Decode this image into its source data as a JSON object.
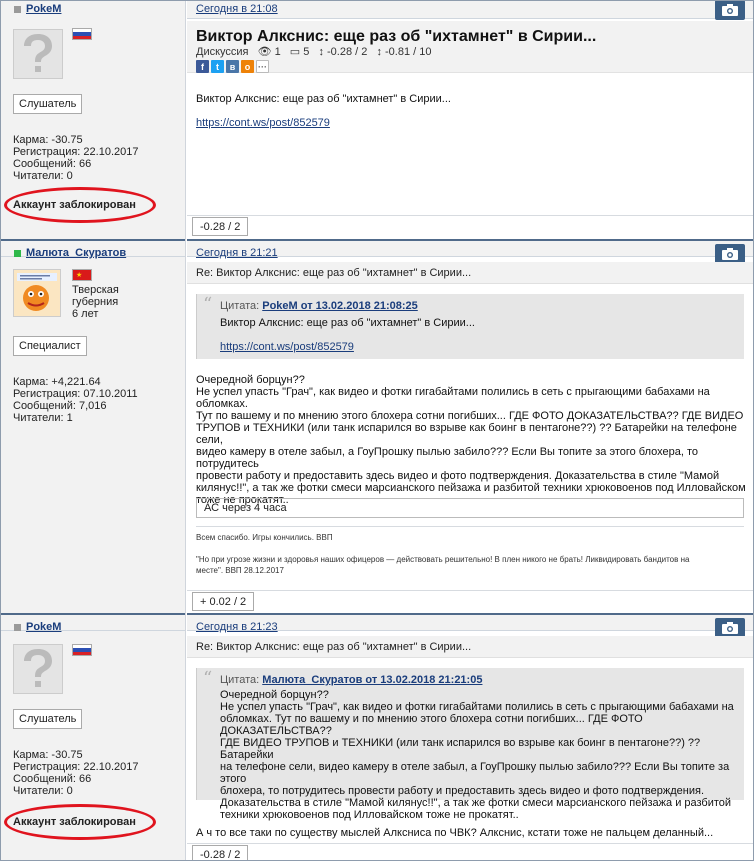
{
  "posts": [
    {
      "user": {
        "name": "PokeM",
        "role": "Слушатель",
        "karma": "Карма: -30.75",
        "registered": "Регистрация: 22.10.2017",
        "messages": "Сообщений: 66",
        "readers": "Читатели: 0",
        "status": "Аккаунт заблокирован"
      },
      "date": "Сегодня в 21:08",
      "title": "Виктор Алкснис: еще раз об \"ихтамнет\" в Сирии...",
      "meta": {
        "section": "Дискуссия",
        "views": "1",
        "comments": "5",
        "rating1": "-0.28 / 2",
        "rating2": "-0.81 / 10"
      },
      "body": "Виктор Алкснис: еще раз об \"ихтамнет\" в Сирии...",
      "link": "https://cont.ws/post/852579",
      "rating": "-0.28 / 2"
    },
    {
      "user": {
        "name": "Малюта_Скуратов",
        "region1": "Тверская",
        "region2": "губерния",
        "years": "6 лет",
        "role": "Специалист",
        "karma": "Карма: +4,221.64",
        "registered": "Регистрация: 07.10.2011",
        "messages": "Сообщений: 7,016",
        "readers": "Читатели: 1"
      },
      "date": "Сегодня в 21:21",
      "subject": "Re: Виктор Алкснис: еще раз об \"ихтамнет\" в Сирии...",
      "quote": {
        "label": "Цитата:",
        "author": "PokeM от 13.02.2018 21:08:25",
        "text": "Виктор Алкснис: еще раз об \"ихтамнет\" в Сирии...",
        "link": "https://cont.ws/post/852579"
      },
      "body_lines": [
        "Очередной борцун??",
        "Не успел упасть \"Грач\", как видео и фотки гигабайтами полились в сеть с прыгающими бабахами на обломках.",
        "Тут по вашему и по мнению этого блохера сотни погибших... ГДЕ ФОТО ДОКАЗАТЕЛЬСТВА?? ГДЕ ВИДЕО",
        "ТРУПОВ и ТЕХНИКИ (или танк испарился во взрыве как боинг в пентагоне??) ?? Батарейки на телефоне сели,",
        "видео камеру в отеле забыл, а ГоуПрошку пылью забило??? Если Вы топите за этого блохера, то потрудитесь",
        "провести работу и предоставить здесь видео и фото подтверждения. Доказательства в стиле \"Мамой",
        "килянус!!\", а так же фотки смеси марсианского пейзажа и разбитой техники хрюковоенов под Илловайском",
        "тоже не прокатят.."
      ],
      "edited": "АС через 4 часа",
      "sig1": "Всем спасибо. Игры кончились. ВВП",
      "sig2a": "\"Но при угрозе жизни и здоровья наших офицеров — действовать решительно! В плен никого не брать! Ликвидировать бандитов на",
      "sig2b": "месте\". ВВП 28.12.2017",
      "rating": "+ 0.02 / 2"
    },
    {
      "user": {
        "name": "PokeM",
        "role": "Слушатель",
        "karma": "Карма: -30.75",
        "registered": "Регистрация: 22.10.2017",
        "messages": "Сообщений: 66",
        "readers": "Читатели: 0",
        "status": "Аккаунт заблокирован"
      },
      "date": "Сегодня в 21:23",
      "subject": "Re: Виктор Алкснис: еще раз об \"ихтамнет\" в Сирии...",
      "quote": {
        "label": "Цитата:",
        "author": "Малюта_Скуратов от 13.02.2018 21:21:05",
        "lines": [
          "Очередной борцун??",
          "Не успел упасть \"Грач\", как видео и фотки гигабайтами полились в сеть с прыгающими бабахами на",
          "обломках. Тут по вашему и по мнению этого блохера сотни погибших... ГДЕ ФОТО ДОКАЗАТЕЛЬСТВА??",
          "ГДЕ ВИДЕО ТРУПОВ и ТЕХНИКИ (или танк испарился во взрыве как боинг в пентагоне??) ?? Батарейки",
          "на телефоне сели, видео камеру в отеле забыл, а ГоуПрошку пылью забило??? Если Вы топите за этого",
          "блохера, то потрудитесь провести работу и предоставить здесь видео и фото подтверждения.",
          "Доказательства в стиле \"Мамой килянус!!\", а так же фотки смеси марсианского пейзажа и разбитой",
          "техники хрюковоенов под Илловайском тоже не прокатят.."
        ]
      },
      "body": "А ч то все таки по существу мыслей Алксниса по ЧВК? Алкснис, кстати тоже не пальцем деланный...",
      "rating": "-0.28 / 2"
    }
  ],
  "colors": {
    "accent": "#1a3d7c",
    "topbar": "#506a8a",
    "ring": "#e0141e",
    "camera": "#3b5f86"
  }
}
